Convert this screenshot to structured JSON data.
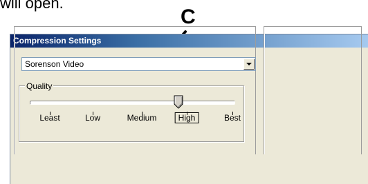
{
  "caption": "will open.",
  "callout": {
    "letter": "C"
  },
  "window": {
    "title": "Compression Settings"
  },
  "compressor": {
    "selected": "Sorenson Video"
  },
  "quality": {
    "group_label": "Quality",
    "levels": [
      "Least",
      "Low",
      "Medium",
      "High",
      "Best"
    ],
    "selected": "High"
  },
  "icons": {
    "dropdown": "chevron-down-icon",
    "thumb": "slider-thumb",
    "arrow": "callout-arrow"
  }
}
